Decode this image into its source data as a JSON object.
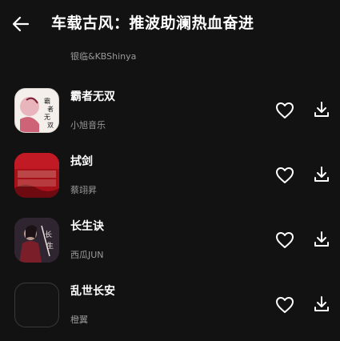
{
  "header": {
    "title": "车载古风：推波助澜热血奋进",
    "back_icon": "arrow-left-icon"
  },
  "songs": [
    {
      "title": "",
      "artist": "银临&KBShinya"
    },
    {
      "title": "霸者无双",
      "artist": "小旭音乐"
    },
    {
      "title": "拭剑",
      "artist": "蔡翊昇"
    },
    {
      "title": "长生诀",
      "artist": "西瓜JUN"
    },
    {
      "title": "乱世长安",
      "artist": "橙翼"
    }
  ],
  "actions": {
    "like_icon": "heart-outline-icon",
    "download_icon": "download-icon"
  },
  "colors": {
    "background": "#121212",
    "text_primary": "#ffffff",
    "text_secondary": "#9a9a9a"
  }
}
